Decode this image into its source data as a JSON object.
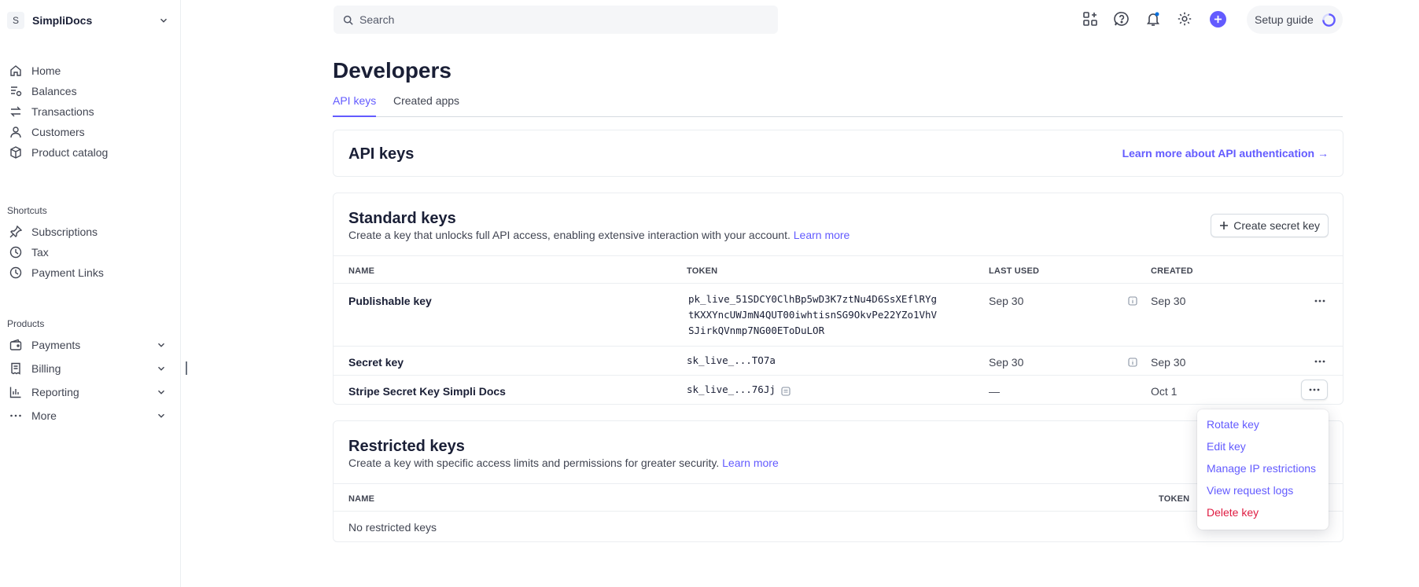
{
  "account": {
    "initial": "S",
    "name": "SimpliDocs"
  },
  "sidebar": {
    "main": [
      {
        "label": "Home",
        "icon": "home-icon"
      },
      {
        "label": "Balances",
        "icon": "balances-icon"
      },
      {
        "label": "Transactions",
        "icon": "transactions-icon"
      },
      {
        "label": "Customers",
        "icon": "customers-icon"
      },
      {
        "label": "Product catalog",
        "icon": "product-catalog-icon"
      }
    ],
    "shortcuts_title": "Shortcuts",
    "shortcuts": [
      {
        "label": "Subscriptions",
        "icon": "pin-icon"
      },
      {
        "label": "Tax",
        "icon": "clock-icon"
      },
      {
        "label": "Payment Links",
        "icon": "clock-icon"
      }
    ],
    "products_title": "Products",
    "products": [
      {
        "label": "Payments",
        "icon": "payments-icon"
      },
      {
        "label": "Billing",
        "icon": "billing-icon"
      },
      {
        "label": "Reporting",
        "icon": "reporting-icon"
      },
      {
        "label": "More",
        "icon": "more-dots-icon"
      }
    ]
  },
  "search": {
    "placeholder": "Search"
  },
  "topbar": {
    "setup_guide": "Setup guide"
  },
  "page": {
    "title": "Developers",
    "tabs": [
      {
        "label": "API keys"
      },
      {
        "label": "Created apps"
      }
    ]
  },
  "api_keys_card": {
    "title": "API keys",
    "learn_more": "Learn more about API authentication →"
  },
  "standard_keys": {
    "title": "Standard keys",
    "description": "Create a key that unlocks full API access, enabling extensive interaction with your account.",
    "learn_more": "Learn more",
    "create_button": "Create secret key",
    "columns": {
      "name": "NAME",
      "token": "TOKEN",
      "last_used": "LAST USED",
      "created": "CREATED"
    },
    "rows": [
      {
        "name": "Publishable key",
        "token_lines": [
          "pk_live_51SDCY0ClhBp5wD3K7ztNu4D6SsXEflRYg",
          "tKXXYncUWJmN4QUT00iwhtisnSG9OkvPe22YZo1VhV",
          "SJirkQVnmp7NG00EToDuLOR"
        ],
        "last_used": "Sep 30",
        "created": "Sep 30"
      },
      {
        "name": "Secret key",
        "token": "sk_live_...TO7a",
        "last_used": "Sep 30",
        "created": "Sep 30"
      },
      {
        "name": "Stripe Secret Key Simpli Docs",
        "token": "sk_live_...76Jj",
        "last_used": "—",
        "created": "Oct 1"
      }
    ]
  },
  "restricted_keys": {
    "title": "Restricted keys",
    "description": "Create a key with specific access limits and permissions for greater security.",
    "learn_more": "Learn more",
    "columns": {
      "name": "NAME",
      "token": "TOKEN"
    },
    "empty": "No restricted keys"
  },
  "row_menu": {
    "items": [
      {
        "label": "Rotate key"
      },
      {
        "label": "Edit key"
      },
      {
        "label": "Manage IP restrictions"
      },
      {
        "label": "View request logs"
      },
      {
        "label": "Delete key"
      }
    ]
  },
  "colors": {
    "accent": "#635bff",
    "danger": "#df1b41",
    "text": "#1a1f36"
  }
}
